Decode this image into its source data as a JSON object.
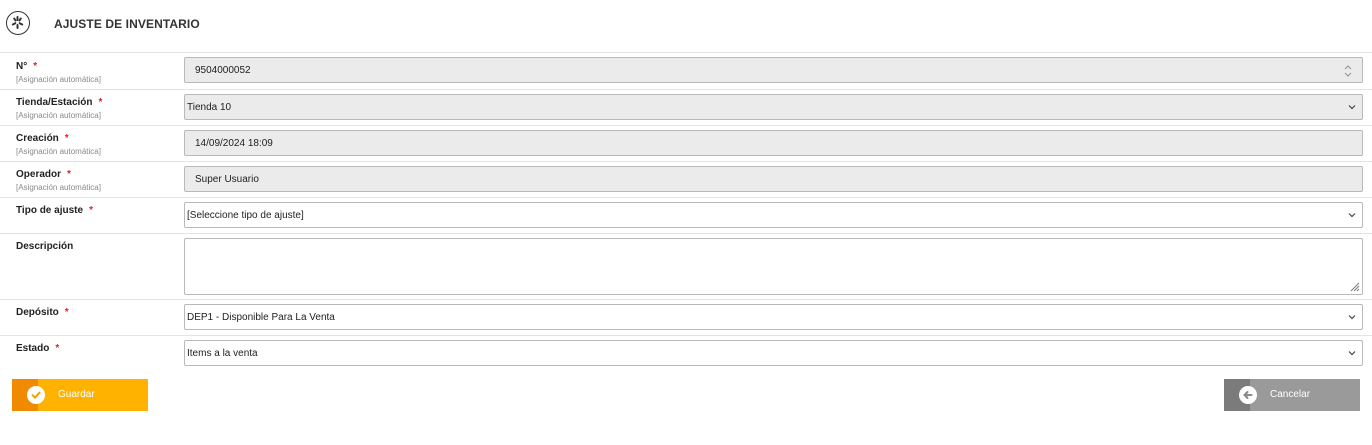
{
  "header": {
    "title": "AJUSTE DE INVENTARIO",
    "logo_icon": "asterisk-logo-icon"
  },
  "required_mark": "*",
  "auto_hint": "[Asignación automática]",
  "form": {
    "numero": {
      "label": "N°",
      "value": "9504000052"
    },
    "tienda": {
      "label": "Tienda/Estación",
      "value": "Tienda 10"
    },
    "creacion": {
      "label": "Creación",
      "value": "14/09/2024 18:09"
    },
    "operador": {
      "label": "Operador",
      "value": "Super Usuario"
    },
    "tipo_ajuste": {
      "label": "Tipo de ajuste",
      "value": "[Seleccione tipo de ajuste]"
    },
    "descripcion": {
      "label": "Descripción",
      "value": ""
    },
    "deposito": {
      "label": "Depósito",
      "value": "DEP1 - Disponible Para La Venta"
    },
    "estado": {
      "label": "Estado",
      "value": "Items a la venta"
    }
  },
  "buttons": {
    "save": {
      "label": "Guardar",
      "icon": "check-icon",
      "color": "#ffb300"
    },
    "cancel": {
      "label": "Cancelar",
      "icon": "arrow-left-icon",
      "color": "#9a9a9a"
    }
  },
  "colors": {
    "required": "#d9232e",
    "readonly_bg": "#ebebeb"
  }
}
